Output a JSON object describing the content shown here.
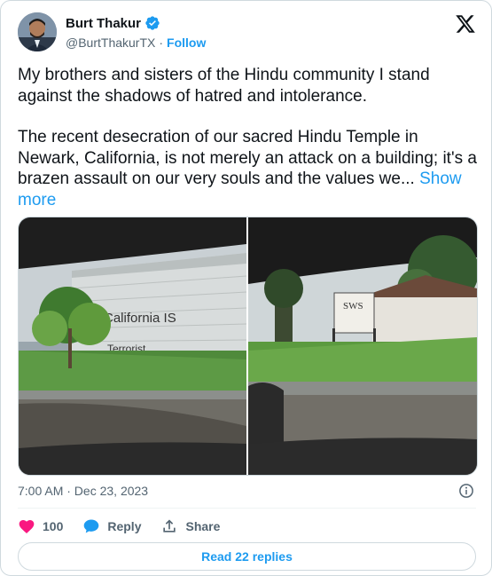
{
  "author": {
    "name": "Burt Thakur",
    "handle": "@BurtThakurTX",
    "separator": "·",
    "follow_label": "Follow",
    "verified_color": "#1d9bf0"
  },
  "brand_icon": "x-logo-icon",
  "tweet": {
    "paragraph_1": "My brothers and sisters of the Hindu community I stand against the shadows of hatred and intolerance.",
    "paragraph_2": "The recent desecration of our sacred Hindu Temple in Newark, California, is not merely an attack on a building; it's a brazen assault on our very souls and the values we... ",
    "show_more_label": "Show more"
  },
  "media": {
    "photo_1": {
      "graffiti_line_1": "California IS",
      "graffiti_line_2": "Terrorist"
    },
    "photo_2": {
      "sign_text": "SWS"
    }
  },
  "meta": {
    "timestamp": "7:00 AM · Dec 23, 2023"
  },
  "actions": {
    "like_count": "100",
    "reply_label": "Reply",
    "share_label": "Share"
  },
  "read_replies_label": "Read 22 replies",
  "colors": {
    "accent": "#1d9bf0",
    "like": "#f91880",
    "text": "#0f1419",
    "muted": "#536471"
  }
}
